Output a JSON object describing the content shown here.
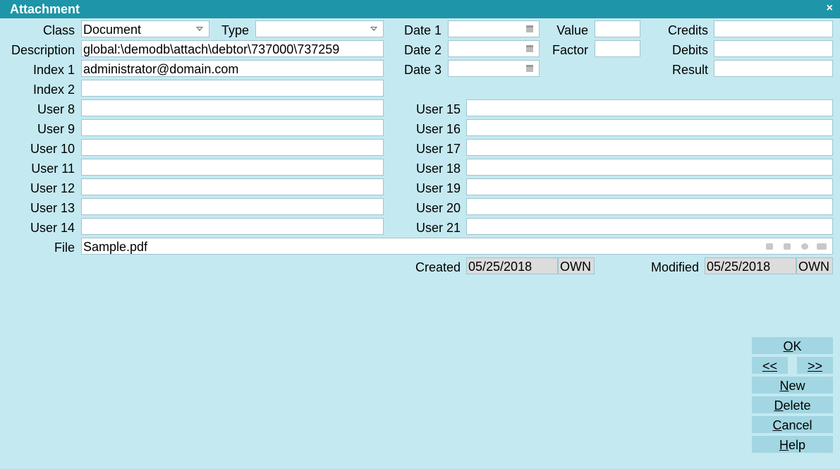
{
  "window": {
    "title": "Attachment",
    "close_glyph": "×"
  },
  "fields": {
    "class_label": "Class",
    "class_value": "Document",
    "type_label": "Type",
    "type_value": "",
    "description_label": "Description",
    "description_value": "global:\\demodb\\attach\\debtor\\737000\\737259",
    "index1_label": "Index 1",
    "index1_value": "administrator@domain.com",
    "index2_label": "Index 2",
    "index2_value": "",
    "date1_label": "Date 1",
    "date1_value": "",
    "date2_label": "Date 2",
    "date2_value": "",
    "date3_label": "Date 3",
    "date3_value": "",
    "value_label": "Value",
    "value_value": "",
    "factor_label": "Factor",
    "factor_value": "",
    "credits_label": "Credits",
    "credits_value": "",
    "debits_label": "Debits",
    "debits_value": "",
    "result_label": "Result",
    "result_value": "",
    "file_label": "File",
    "file_value": "Sample.pdf",
    "created_label": "Created",
    "created_date": "05/25/2018",
    "created_by": "OWN",
    "modified_label": "Modified",
    "modified_date": "05/25/2018",
    "modified_by": "OWN"
  },
  "user_fields_left": [
    {
      "label": "User 8",
      "value": ""
    },
    {
      "label": "User 9",
      "value": ""
    },
    {
      "label": "User 10",
      "value": ""
    },
    {
      "label": "User 11",
      "value": ""
    },
    {
      "label": "User 12",
      "value": ""
    },
    {
      "label": "User 13",
      "value": ""
    },
    {
      "label": "User 14",
      "value": ""
    }
  ],
  "user_fields_right": [
    {
      "label": "User 15",
      "value": ""
    },
    {
      "label": "User 16",
      "value": ""
    },
    {
      "label": "User 17",
      "value": ""
    },
    {
      "label": "User 18",
      "value": ""
    },
    {
      "label": "User 19",
      "value": ""
    },
    {
      "label": "User 20",
      "value": ""
    },
    {
      "label": "User 21",
      "value": ""
    }
  ],
  "file_icons": [
    "folder-open-icon",
    "print-icon",
    "gear-icon",
    "key-lock-icon"
  ],
  "buttons": {
    "ok": "OK",
    "prev": "<<",
    "next": ">>",
    "new": "New",
    "delete": "Delete",
    "cancel": "Cancel",
    "help": "Help"
  },
  "colors": {
    "titlebar": "#1e95a8",
    "background": "#c5e9f1",
    "button": "#a2d6e2"
  }
}
